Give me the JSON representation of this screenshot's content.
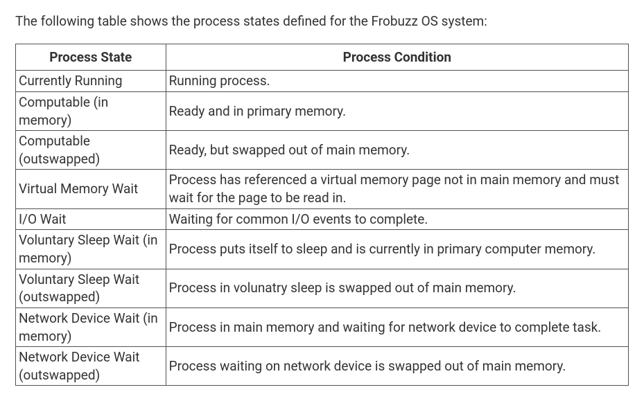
{
  "intro": "The following table shows the process states defined for the Frobuzz OS system:",
  "table": {
    "headers": {
      "state": "Process State",
      "condition": "Process Condition"
    },
    "rows": [
      {
        "state": "Currently Running",
        "condition": "Running process."
      },
      {
        "state": "Computable (in memory)",
        "condition": "Ready and in primary memory."
      },
      {
        "state": "Computable (outswapped)",
        "condition": "Ready, but swapped out of main memory."
      },
      {
        "state": "Virtual Memory Wait",
        "condition": "Process has referenced a virtual memory page not in main memory and must wait for the page to be read in."
      },
      {
        "state": "I/O Wait",
        "condition": "Waiting for common I/O events to complete."
      },
      {
        "state": "Voluntary Sleep Wait (in memory)",
        "condition": "Process puts itself to sleep and is currently in primary computer memory."
      },
      {
        "state": "Voluntary Sleep Wait (outswapped)",
        "condition": "Process in volunatry sleep is swapped out of main memory."
      },
      {
        "state": "Network Device Wait (in memory)",
        "condition": "Process in main memory and waiting for network device to complete task."
      },
      {
        "state": "Network Device Wait (outswapped)",
        "condition": "Process waiting on network device is swapped out of main memory."
      }
    ]
  }
}
